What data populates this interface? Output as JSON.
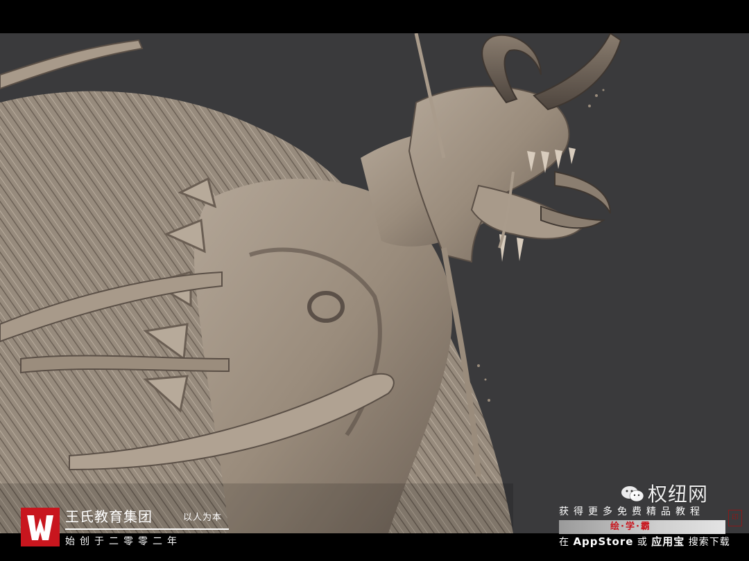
{
  "brand": {
    "logo_letter": "W",
    "name": "王氏教育集团",
    "motto": "以人为本",
    "founded": "始创于二零零二年"
  },
  "promo": {
    "line1": "获得更多免费精品教程",
    "app_name": "绘·学·霸",
    "line2_prefix": "在",
    "store_appstore": "AppStore",
    "line2_or": "或",
    "store_yingyongbao": "应用宝",
    "line2_suffix": "搜索下载",
    "seal_char": "印"
  },
  "watermark": {
    "text": "权纽网",
    "icon": "wechat-icon"
  },
  "colors": {
    "brand_red": "#c8161e",
    "viewport_bg": "#3a3a3c",
    "sculpt_clay": "#9d8f80"
  }
}
